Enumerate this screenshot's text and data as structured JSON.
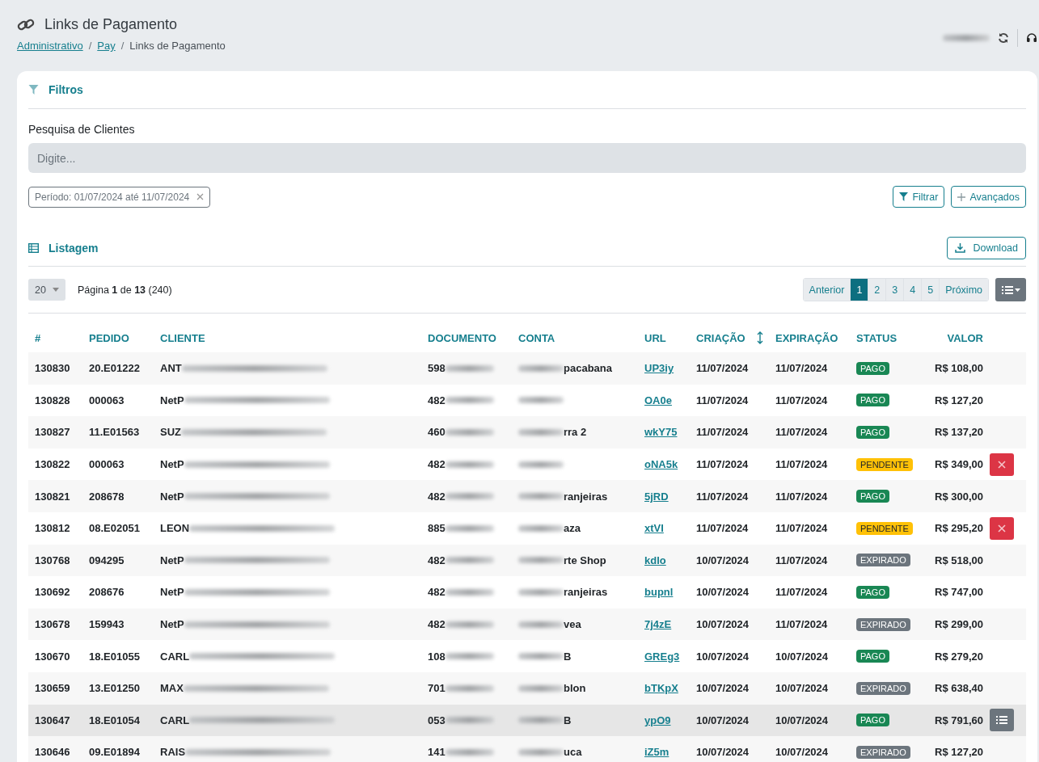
{
  "header": {
    "title": "Links de Pagamento",
    "separators": [
      "/",
      "/"
    ],
    "breadcrumb": [
      {
        "label": "Administrativo",
        "link": true
      },
      {
        "label": "Pay",
        "link": true
      },
      {
        "label": "Links de Pagamento",
        "link": false
      }
    ]
  },
  "filters": {
    "title": "Filtros",
    "search_label": "Pesquisa de Clientes",
    "placeholder": "Digite...",
    "chips": [
      "Período: 01/07/2024 até 11/07/2024"
    ],
    "buttons": [
      {
        "label": "Filtrar",
        "kind": "filter"
      },
      {
        "label": "Avançados",
        "kind": "add"
      }
    ]
  },
  "listing": {
    "title": "Listagem",
    "download": "Download",
    "page_size": "20",
    "page_info": "Página **1** de **13** (240)",
    "pagination": [
      {
        "label": "Anterior",
        "selected": false
      },
      {
        "label": "1",
        "selected": true
      },
      {
        "label": "2",
        "selected": false
      },
      {
        "label": "3",
        "selected": false
      },
      {
        "label": "4",
        "selected": false
      },
      {
        "label": "5",
        "selected": false
      },
      {
        "label": "Próximo",
        "selected": false
      }
    ]
  },
  "table": {
    "columns": [
      {
        "label": "#",
        "sorted": false
      },
      {
        "label": "PEDIDO",
        "sorted": false
      },
      {
        "label": "CLIENTE",
        "sorted": false
      },
      {
        "label": "DOCUMENTO",
        "sorted": false
      },
      {
        "label": "CONTA",
        "sorted": false
      },
      {
        "label": "URL",
        "sorted": false
      },
      {
        "label": "CRIAÇÃO",
        "sorted": true
      },
      {
        "label": "EXPIRAÇÃO",
        "sorted": false
      },
      {
        "label": "STATUS",
        "sorted": false
      },
      {
        "label": "VALOR",
        "sorted": false
      }
    ],
    "rows": [
      {
        "id": "130830",
        "pedido": "20.E01222",
        "cliente": "ANT",
        "documento": "598",
        "conta": "pacabana",
        "url": "UP3iy",
        "criacao": "11/07/2024",
        "expiracao": "11/07/2024",
        "status": {
          "label": "PAGO",
          "color": "#198754"
        },
        "valor": "R$ 108,00",
        "cancelable": false,
        "selected": false
      },
      {
        "id": "130828",
        "pedido": "000063",
        "cliente": "NetP",
        "documento": "482",
        "url": "OA0e",
        "criacao": "11/07/2024",
        "expiracao": "11/07/2024",
        "status": {
          "label": "PAGO",
          "color": "#198754"
        },
        "valor": "R$ 127,20",
        "cancelable": false,
        "selected": false
      },
      {
        "id": "130827",
        "pedido": "11.E01563",
        "cliente": "SUZ",
        "documento": "460",
        "conta": "rra 2",
        "url": "wkY75",
        "criacao": "11/07/2024",
        "expiracao": "11/07/2024",
        "status": {
          "label": "PAGO",
          "color": "#198754"
        },
        "valor": "R$ 137,20",
        "cancelable": false,
        "selected": false
      },
      {
        "id": "130822",
        "pedido": "000063",
        "cliente": "NetP",
        "documento": "482",
        "url": "oNA5k",
        "criacao": "11/07/2024",
        "expiracao": "11/07/2024",
        "status": {
          "label": "PENDENTE",
          "color": "#ffc107"
        },
        "valor": "R$ 349,00",
        "cancelable": true,
        "selected": false
      },
      {
        "id": "130821",
        "pedido": "208678",
        "cliente": "NetP",
        "documento": "482",
        "conta": "ranjeiras",
        "url": "5jRD",
        "criacao": "11/07/2024",
        "expiracao": "11/07/2024",
        "status": {
          "label": "PAGO",
          "color": "#198754"
        },
        "valor": "R$ 300,00",
        "cancelable": false,
        "selected": false
      },
      {
        "id": "130812",
        "pedido": "08.E02051",
        "cliente": "LEON",
        "documento": "885",
        "conta": "aza",
        "url": "xtVI",
        "criacao": "11/07/2024",
        "expiracao": "11/07/2024",
        "status": {
          "label": "PENDENTE",
          "color": "#ffc107"
        },
        "valor": "R$ 295,20",
        "cancelable": true,
        "selected": false
      },
      {
        "id": "130768",
        "pedido": "094295",
        "cliente": "NetP",
        "documento": "482",
        "conta": "rte Shop",
        "url": "kdlo",
        "criacao": "10/07/2024",
        "expiracao": "11/07/2024",
        "status": {
          "label": "EXPIRADO",
          "color": "#6c757d"
        },
        "valor": "R$ 518,00",
        "cancelable": false,
        "selected": false
      },
      {
        "id": "130692",
        "pedido": "208676",
        "cliente": "NetP",
        "documento": "482",
        "conta": "ranjeiras",
        "url": "bupnl",
        "criacao": "10/07/2024",
        "expiracao": "11/07/2024",
        "status": {
          "label": "PAGO",
          "color": "#198754"
        },
        "valor": "R$ 747,00",
        "cancelable": false,
        "selected": false
      },
      {
        "id": "130678",
        "pedido": "159943",
        "cliente": "NetP",
        "documento": "482",
        "conta": "vea",
        "url": "7j4zE",
        "criacao": "10/07/2024",
        "expiracao": "11/07/2024",
        "status": {
          "label": "EXPIRADO",
          "color": "#6c757d"
        },
        "valor": "R$ 299,00",
        "cancelable": false,
        "selected": false
      },
      {
        "id": "130670",
        "pedido": "18.E01055",
        "cliente": "CARL",
        "documento": "108",
        "conta": "B",
        "url": "GREg3",
        "criacao": "10/07/2024",
        "expiracao": "10/07/2024",
        "status": {
          "label": "PAGO",
          "color": "#198754"
        },
        "valor": "R$ 279,20",
        "cancelable": false,
        "selected": false
      },
      {
        "id": "130659",
        "pedido": "13.E01250",
        "cliente": "MAX",
        "documento": "701",
        "conta": "blon",
        "url": "bTKpX",
        "criacao": "10/07/2024",
        "expiracao": "10/07/2024",
        "status": {
          "label": "EXPIRADO",
          "color": "#6c757d"
        },
        "valor": "R$ 638,40",
        "cancelable": false,
        "selected": false
      },
      {
        "id": "130647",
        "pedido": "18.E01054",
        "cliente": "CARL",
        "documento": "053",
        "conta": "B",
        "url": "ypO9",
        "criacao": "10/07/2024",
        "expiracao": "10/07/2024",
        "status": {
          "label": "PAGO",
          "color": "#198754"
        },
        "valor": "R$ 791,60",
        "cancelable": false,
        "selected": true
      },
      {
        "id": "130646",
        "pedido": "09.E01894",
        "cliente": "RAIS",
        "documento": "141",
        "conta": "uca",
        "url": "iZ5m",
        "criacao": "10/07/2024",
        "expiracao": "10/07/2024",
        "status": {
          "label": "EXPIRADO",
          "color": "#6c757d"
        },
        "valor": "R$ 127,20",
        "cancelable": false,
        "selected": false
      }
    ]
  }
}
